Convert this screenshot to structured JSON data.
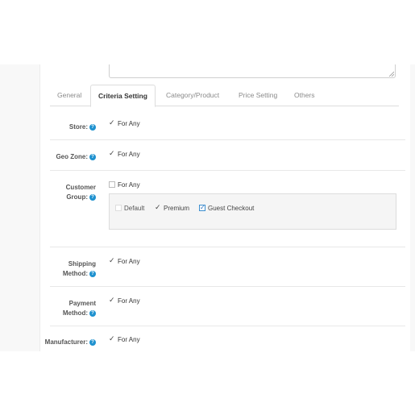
{
  "tabs": [
    {
      "label": "General",
      "active": false
    },
    {
      "label": "Criteria Setting",
      "active": true
    },
    {
      "label": "Category/Product",
      "active": false
    },
    {
      "label": "Price Setting",
      "active": false
    },
    {
      "label": "Others",
      "active": false
    }
  ],
  "store": {
    "label": "Store:",
    "option": "For Any",
    "checked": true
  },
  "geo_zone": {
    "label": "Geo Zone:",
    "option": "For Any",
    "checked": true
  },
  "customer_group": {
    "label_line1": "Customer",
    "label_line2": "Group:",
    "option": "For Any",
    "checked": false,
    "groups": [
      {
        "label": "Default",
        "checked": false
      },
      {
        "label": "Premium",
        "checked": true
      },
      {
        "label": "Guest Checkout",
        "checked": true
      }
    ]
  },
  "shipping_method": {
    "label_line1": "Shipping",
    "label_line2": "Method:",
    "option": "For Any",
    "checked": true
  },
  "payment_method": {
    "label_line1": "Payment",
    "label_line2": "Method:",
    "option": "For Any",
    "checked": true
  },
  "manufacturer": {
    "label": "Manufacturer:",
    "option": "For Any",
    "checked": true
  },
  "colors": {
    "help_icon": "#1e91cf",
    "checkbox_checked": "#3d8fcf"
  }
}
